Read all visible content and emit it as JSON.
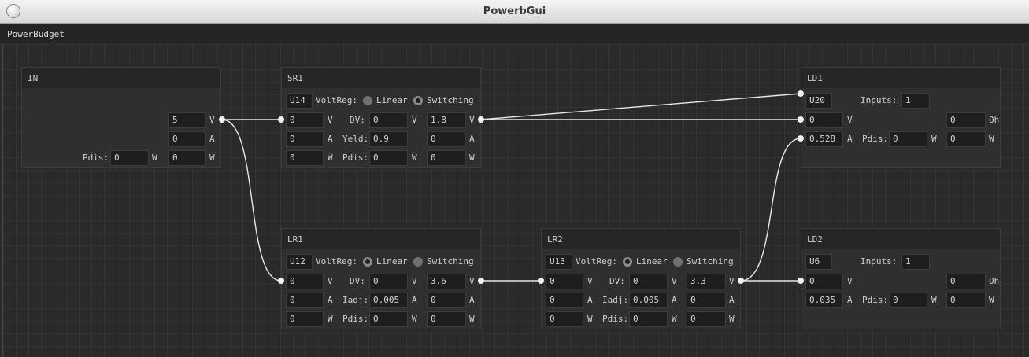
{
  "window": {
    "title": "PowerbGui"
  },
  "menu": {
    "label": "PowerBudget"
  },
  "nodes": {
    "in": {
      "title": "IN",
      "voltage": "5",
      "current": "0",
      "pdis_label": "Pdis:",
      "pdis": "0",
      "power": "0"
    },
    "sr1": {
      "title": "SR1",
      "id": "U14",
      "voltreg_label": "VoltReg:",
      "opt_linear": "Linear",
      "opt_switching": "Switching",
      "in_v": "0",
      "in_a": "0",
      "in_w": "0",
      "dv_label": "DV:",
      "dv": "0",
      "param_label": "Yeld:",
      "param": "0.9",
      "pdis_label": "Pdis:",
      "pdis": "0",
      "out_v": "1.8",
      "out_a": "0",
      "out_w": "0",
      "selected": "switching"
    },
    "lr1": {
      "title": "LR1",
      "id": "U12",
      "voltreg_label": "VoltReg:",
      "opt_linear": "Linear",
      "opt_switching": "Switching",
      "in_v": "0",
      "in_a": "0",
      "in_w": "0",
      "dv_label": "DV:",
      "dv": "0",
      "param_label": "Iadj:",
      "param": "0.005",
      "pdis_label": "Pdis:",
      "pdis": "0",
      "out_v": "3.6",
      "out_a": "0",
      "out_w": "0",
      "selected": "linear"
    },
    "lr2": {
      "title": "LR2",
      "id": "U13",
      "voltreg_label": "VoltReg:",
      "opt_linear": "Linear",
      "opt_switching": "Switching",
      "in_v": "0",
      "in_a": "0",
      "in_w": "0",
      "dv_label": "DV:",
      "dv": "0",
      "param_label": "Iadj:",
      "param": "0.005",
      "pdis_label": "Pdis:",
      "pdis": "0",
      "out_v": "3.3",
      "out_a": "0",
      "out_w": "0",
      "selected": "linear"
    },
    "ld1": {
      "title": "LD1",
      "id": "U20",
      "inputs_label": "Inputs:",
      "inputs": "1",
      "v": "0",
      "a": "0.528",
      "pdis_label": "Pdis:",
      "pdis": "0",
      "ohm": "0",
      "w": "0"
    },
    "ld2": {
      "title": "LD2",
      "id": "U6",
      "inputs_label": "Inputs:",
      "inputs": "1",
      "v": "0",
      "a": "0.035",
      "pdis_label": "Pdis:",
      "pdis": "0",
      "ohm": "0",
      "w": "0"
    }
  },
  "units": {
    "v": "V",
    "a": "A",
    "w": "W",
    "ohm": "Oh"
  }
}
